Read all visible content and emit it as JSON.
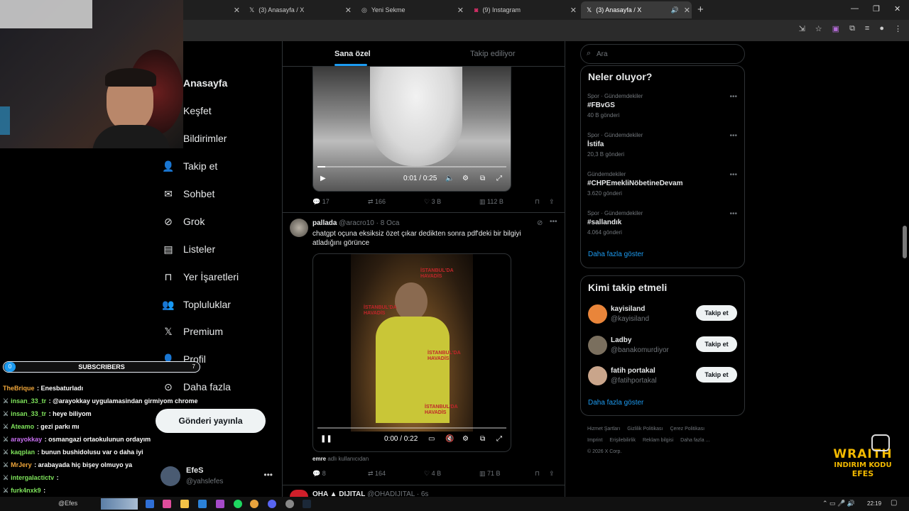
{
  "browser": {
    "tabs": [
      {
        "label": "",
        "icon": "x-logo-icon"
      },
      {
        "label": "(3) Anasayfa / X",
        "icon": "x-logo-icon"
      },
      {
        "label": "Yeni Sekme",
        "icon": "chrome-icon"
      },
      {
        "label": "(9) Instagram",
        "icon": "instagram-icon"
      },
      {
        "label": "(3) Anasayfa / X",
        "icon": "x-logo-icon"
      }
    ],
    "new_tab": "+"
  },
  "nav": {
    "items": [
      {
        "label": "Anasayfa",
        "icon": "home-icon"
      },
      {
        "label": "Keşfet",
        "icon": "search-icon"
      },
      {
        "label": "Bildirimler",
        "icon": "bell-icon"
      },
      {
        "label": "Takip et",
        "icon": "person-plus-icon"
      },
      {
        "label": "Sohbet",
        "icon": "mail-icon"
      },
      {
        "label": "Grok",
        "icon": "grok-icon"
      },
      {
        "label": "Listeler",
        "icon": "list-icon"
      },
      {
        "label": "Yer İşaretleri",
        "icon": "bookmark-icon"
      },
      {
        "label": "Topluluklar",
        "icon": "people-icon"
      },
      {
        "label": "Premium",
        "icon": "x-logo-icon"
      },
      {
        "label": "Profil",
        "icon": "person-icon"
      },
      {
        "label": "Daha fazla",
        "icon": "more-circle-icon"
      }
    ],
    "post_button": "Gönderi yayınla",
    "account": {
      "name": "EfeS",
      "handle": "@yahslefes"
    }
  },
  "feed": {
    "tabs": [
      "Sana özel",
      "Takip ediliyor"
    ],
    "video1": {
      "time": "0:01 / 0:25",
      "progress": 0.04
    },
    "tweet1_actions": {
      "replies": "17",
      "reposts": "166",
      "likes": "3 B",
      "views": "112 B"
    },
    "tweet2": {
      "name": "pallada",
      "handle": "@aracro10",
      "date": "· 8 Oca",
      "text": "chatgpt oçuna eksiksiz özet çıkar dedikten sonra pdf'deki bir bilgiyi atladığını görünce",
      "video_time": "0:00 / 0:22",
      "video_watermark": "İSTANBUL'DA HAVADİS",
      "caption_user": "emre",
      "caption_rest": "adlı kullanıcıdan",
      "actions": {
        "replies": "8",
        "reposts": "164",
        "likes": "4 B",
        "views": "71 B"
      }
    },
    "tweet3": {
      "name": "OHA ▲ DIJITAL",
      "handle": "@OHADIJITAL · 6s"
    }
  },
  "sidebar": {
    "search_placeholder": "Ara",
    "trends_title": "Neler oluyor?",
    "trends": [
      {
        "category": "Spor · Gündemdekiler",
        "tag": "#FBvGS",
        "count": "40 B gönderi"
      },
      {
        "category": "Spor · Gündemdekiler",
        "tag": "İstifa",
        "count": "20,3 B gönderi"
      },
      {
        "category": "Gündemdekiler",
        "tag": "#CHPEmekliNöbetineDevam",
        "count": "3.620 gönderi"
      },
      {
        "category": "Spor · Gündemdekiler",
        "tag": "#sallandık",
        "count": "4.064 gönderi"
      }
    ],
    "show_more": "Daha fazla göster",
    "who_title": "Kimi takip etmeli",
    "who": [
      {
        "name": "kayisiland",
        "handle": "@kayisiland",
        "button": "Takip et",
        "avatar_color": "#e9853a"
      },
      {
        "name": "Ladby",
        "handle": "@banakomurdiyor",
        "button": "Takip et",
        "avatar_color": "#7a6f5e"
      },
      {
        "name": "fatih portakal",
        "handle": "@fatihportakal",
        "button": "Takip et",
        "avatar_color": "#c9a58b"
      }
    ],
    "who_more": "Daha fazla göster",
    "footer_links": [
      "Hizmet Şartları",
      "Gizlilik Politikası",
      "Çerez Politikası",
      "Imprint",
      "Erişilebilirlik",
      "Reklam bilgisi",
      "Daha fazla ..."
    ],
    "copyright": "© 2026 X Corp."
  },
  "stream": {
    "subscribers_label": "SUBSCRIBERS",
    "sub_left": "0",
    "sub_right": "7",
    "chat": [
      {
        "user": "TheBrique",
        "text": ": Enesbaturladı",
        "color": "#f0a63a"
      },
      {
        "user": "insan_33_tr",
        "text": ": @arayokkay uygulamasindan girmiyom chrome",
        "color": "#7ee35b"
      },
      {
        "user": "insan_33_tr",
        "text": ": heye biliyom",
        "color": "#7ee35b"
      },
      {
        "user": "Ateamo",
        "text": ": gezi parkı mı",
        "color": "#7ee35b"
      },
      {
        "user": "arayokkay",
        "text": ": osmangazi ortaokulunun ordayım",
        "color": "#c76ef0"
      },
      {
        "user": "kaqplan",
        "text": ": bunun bushidolusu var o daha iyi",
        "color": "#7ee35b"
      },
      {
        "user": "MrJery",
        "text": ": arabayada hiç bişey olmuyo ya",
        "color": "#f0a63a"
      },
      {
        "user": "intergalactictv",
        "text": ":",
        "color": "#7ee35b"
      },
      {
        "user": "furk4nxk9",
        "text": ":",
        "color": "#7ee35b"
      }
    ],
    "brand_line1": "WRAITH",
    "brand_line2": "INDIRIM KODU",
    "brand_line3": "EFES"
  },
  "taskbar": {
    "search_text": "@Efes",
    "time": "22:19"
  }
}
